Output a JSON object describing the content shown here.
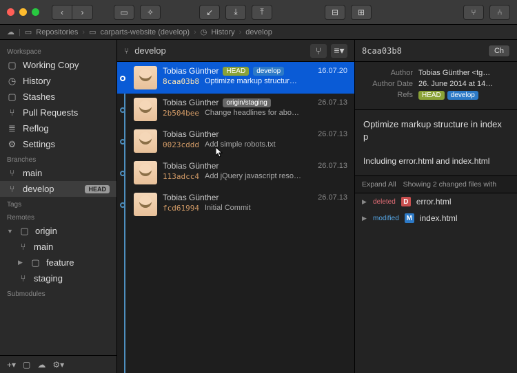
{
  "pathbar": {
    "items": [
      "Repositories",
      "carparts-website (develop)",
      "History",
      "develop"
    ]
  },
  "sidebar": {
    "workspace": {
      "header": "Workspace",
      "items": [
        {
          "label": "Working Copy",
          "icon": "folder"
        },
        {
          "label": "History",
          "icon": "clock"
        },
        {
          "label": "Stashes",
          "icon": "folder"
        },
        {
          "label": "Pull Requests",
          "icon": "pr"
        },
        {
          "label": "Reflog",
          "icon": "list"
        },
        {
          "label": "Settings",
          "icon": "gear"
        }
      ]
    },
    "branches": {
      "header": "Branches",
      "items": [
        {
          "label": "main",
          "icon": "branch"
        },
        {
          "label": "develop",
          "icon": "branch",
          "selected": true,
          "head": "HEAD"
        }
      ]
    },
    "tags": {
      "header": "Tags"
    },
    "remotes": {
      "header": "Remotes",
      "origin": {
        "label": "origin",
        "icon": "folder"
      },
      "items": [
        {
          "label": "main",
          "icon": "branch"
        },
        {
          "label": "feature",
          "icon": "folder",
          "expandable": true
        },
        {
          "label": "staging",
          "icon": "branch"
        }
      ]
    },
    "submodules": {
      "header": "Submodules"
    }
  },
  "commits_header": {
    "branch": "develop"
  },
  "commits": [
    {
      "author": "Tobias Günther",
      "refs": [
        {
          "label": "HEAD",
          "cls": "ref-head"
        },
        {
          "label": "develop",
          "cls": "ref-branch"
        }
      ],
      "date": "16.07.20",
      "hash": "8caa03b8",
      "message": "Optimize markup structur…",
      "selected": true
    },
    {
      "author": "Tobias Günther",
      "refs": [
        {
          "label": "origin/staging",
          "cls": "ref-remote"
        }
      ],
      "date": "26.07.13",
      "hash": "2b504bee",
      "message": "Change headlines for abo…"
    },
    {
      "author": "Tobias Günther",
      "refs": [],
      "date": "26.07.13",
      "hash": "0023cddd",
      "message": "Add simple robots.txt"
    },
    {
      "author": "Tobias Günther",
      "refs": [],
      "date": "26.07.13",
      "hash": "113adcc4",
      "message": "Add jQuery javascript reso…"
    },
    {
      "author": "Tobias Günther",
      "refs": [],
      "date": "26.07.13",
      "hash": "fcd61994",
      "message": "Initial Commit"
    }
  ],
  "detail": {
    "hash": "8caa03b8",
    "checkout_label": "Ch",
    "meta": {
      "author_label": "Author",
      "author_value": "Tobias Günther <tg…",
      "date_label": "Author Date",
      "date_value": "26. June 2014 at 14…",
      "refs_label": "Refs",
      "refs": [
        {
          "label": "HEAD",
          "cls": "ref-head"
        },
        {
          "label": "develop",
          "cls": "ref-branch"
        }
      ]
    },
    "message_title": "Optimize markup structure in index p",
    "message_body": "Including error.html and index.html",
    "files_header": {
      "expand": "Expand All",
      "showing": "Showing 2 changed files with"
    },
    "files": [
      {
        "status": "deleted",
        "status_cls": "del",
        "badge": "D",
        "name": "error.html"
      },
      {
        "status": "modified",
        "status_cls": "mod",
        "badge": "M",
        "name": "index.html"
      }
    ]
  }
}
